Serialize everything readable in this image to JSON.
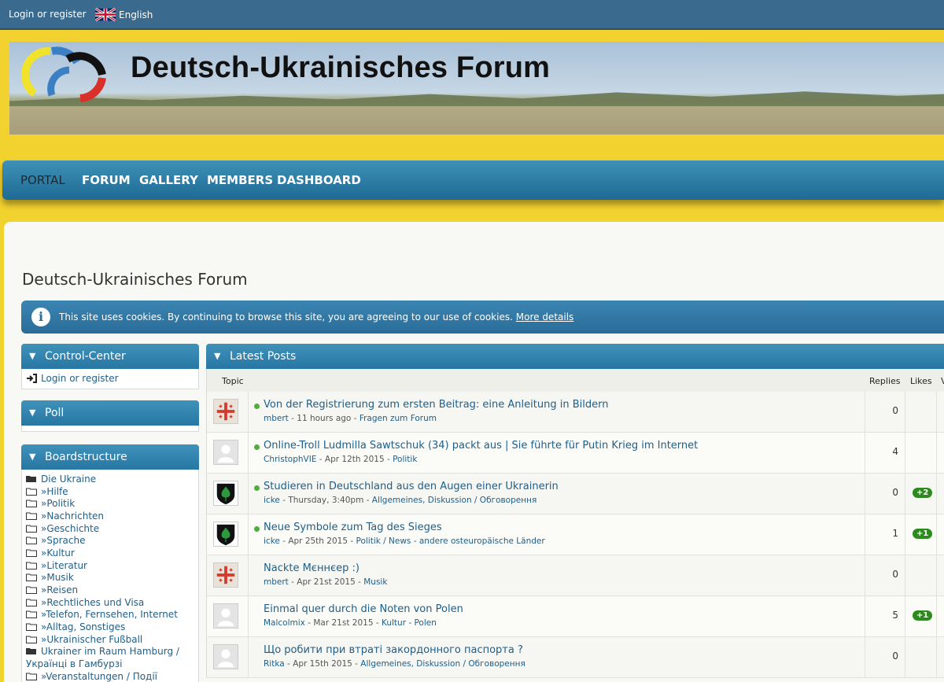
{
  "topbar": {
    "login": "Login or register",
    "language": "English"
  },
  "banner": {
    "title": "Deutsch-Ukrainisches Forum"
  },
  "nav": {
    "items": [
      "PORTAL",
      "FORUM",
      "GALLERY",
      "MEMBERS",
      "DASHBOARD"
    ],
    "active": "PORTAL"
  },
  "page": {
    "title": "Deutsch-Ukrainisches Forum"
  },
  "cookie": {
    "message": "This site uses cookies. By continuing to browse this site, you are agreeing to our use of cookies.",
    "more": "More details"
  },
  "control_center": {
    "title": "Control-Center",
    "login": "Login or register"
  },
  "poll": {
    "title": "Poll"
  },
  "boardstructure": {
    "title": "Boardstructure",
    "items": [
      "Die Ukraine",
      "»Hilfe",
      "»Politik",
      "»Nachrichten",
      "»Geschichte",
      "»Sprache",
      "»Kultur",
      "»Literatur",
      "»Musik",
      "»Reisen",
      "»Rechtliches und Visa",
      "»Telefon, Fernsehen, Internet",
      "»Alltag, Sonstiges",
      "»Ukrainischer Fußball",
      "Ukrainer im Raum Hamburg /",
      "Українці в Гамбурзі",
      "»Veranstaltungen / Події"
    ]
  },
  "latest": {
    "title": "Latest Posts",
    "columns": {
      "topic": "Topic",
      "replies": "Replies",
      "likes": "Likes",
      "extra": "V"
    },
    "posts": [
      {
        "title": "Von der Registrierung zum ersten Beitrag: eine Anleitung in Bildern",
        "author": "mbert",
        "time": " - 11 hours ago - ",
        "board": "Fragen zum Forum",
        "replies": "0",
        "likes": "",
        "new": true,
        "avatar": "flag"
      },
      {
        "title": "Online-Troll Ludmilla Sawtschuk (34) packt aus | Sie führte für Putin Krieg im Internet",
        "author": "ChristophVIE",
        "time": " - Apr 12th 2015 - ",
        "board": "Politik",
        "replies": "4",
        "likes": "",
        "new": true,
        "avatar": "default"
      },
      {
        "title": "Studieren in Deutschland aus den Augen einer Ukrainerin",
        "author": "icke",
        "time": " - Thursday, 3:40pm - ",
        "board": "Allgemeines, Diskussion / Обговорення",
        "replies": "0",
        "likes": "+2",
        "new": true,
        "avatar": "shield"
      },
      {
        "title": "Neue Symbole zum Tag des Sieges",
        "author": "icke",
        "time": " - Apr 25th 2015 - ",
        "board": "Politik / News - andere osteuropäische Länder",
        "replies": "1",
        "likes": "+1",
        "new": true,
        "avatar": "shield"
      },
      {
        "title": "Nackte Мєннєер :)",
        "author": "mbert",
        "time": " - Apr 21st 2015 - ",
        "board": "Musik",
        "replies": "0",
        "likes": "",
        "new": false,
        "avatar": "flag"
      },
      {
        "title": "Einmal quer durch die Noten von Polen",
        "author": "Malcolmix",
        "time": " - Mar 21st 2015 - ",
        "board": "Kultur - Polen",
        "replies": "5",
        "likes": "+1",
        "new": false,
        "avatar": "default"
      },
      {
        "title": "Що робити при втраті закордонного паспорта ?",
        "author": "Ritka",
        "time": " - Apr 15th 2015 - ",
        "board": "Allgemeines, Diskussion / Обговорення",
        "replies": "0",
        "likes": "",
        "new": false,
        "avatar": "default"
      }
    ]
  },
  "colors": {
    "accent_blue": "#2776a3",
    "gold": "#f2d22e",
    "link": "#1d5f8a",
    "like_green": "#2d8a1e"
  }
}
